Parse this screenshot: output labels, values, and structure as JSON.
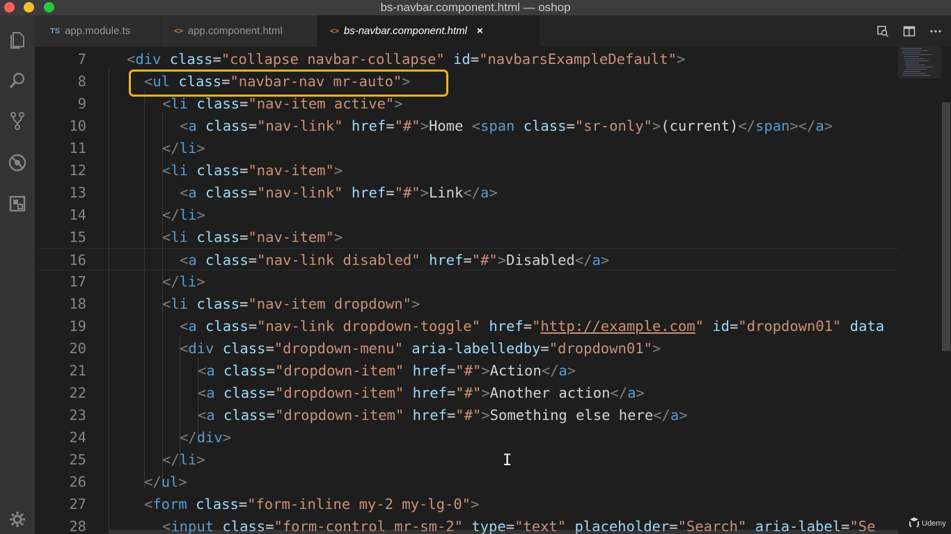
{
  "window": {
    "title": "bs-navbar.component.html — oshop"
  },
  "activity_bar": {
    "icons": [
      "files-icon",
      "search-icon",
      "source-control-icon",
      "debug-icon",
      "extensions-icon",
      "settings-gear-icon"
    ]
  },
  "tabs": [
    {
      "icon_text": "TS",
      "label": "app.module.ts",
      "active": false
    },
    {
      "icon_text": "<>",
      "label": "app.component.html",
      "active": false
    },
    {
      "icon_text": "<>",
      "label": "bs-navbar.component.html",
      "active": true,
      "close": "×"
    }
  ],
  "editor": {
    "lines": [
      {
        "n": "7"
      },
      {
        "n": "8"
      },
      {
        "n": "9"
      },
      {
        "n": "10"
      },
      {
        "n": "11"
      },
      {
        "n": "12"
      },
      {
        "n": "13"
      },
      {
        "n": "14"
      },
      {
        "n": "15"
      },
      {
        "n": "16"
      },
      {
        "n": "17"
      },
      {
        "n": "18"
      },
      {
        "n": "19"
      },
      {
        "n": "20"
      },
      {
        "n": "21"
      },
      {
        "n": "22"
      },
      {
        "n": "23"
      },
      {
        "n": "24"
      },
      {
        "n": "25"
      },
      {
        "n": "26"
      },
      {
        "n": "27"
      },
      {
        "n": "28"
      }
    ],
    "highlight_color": "#f2b418"
  },
  "watermark": {
    "label": "Udemy"
  },
  "colors": {
    "tag": "#569cd6",
    "attr": "#9cdcfe",
    "string": "#ce9178",
    "text": "#d4d4d4",
    "line_number": "#858585"
  }
}
